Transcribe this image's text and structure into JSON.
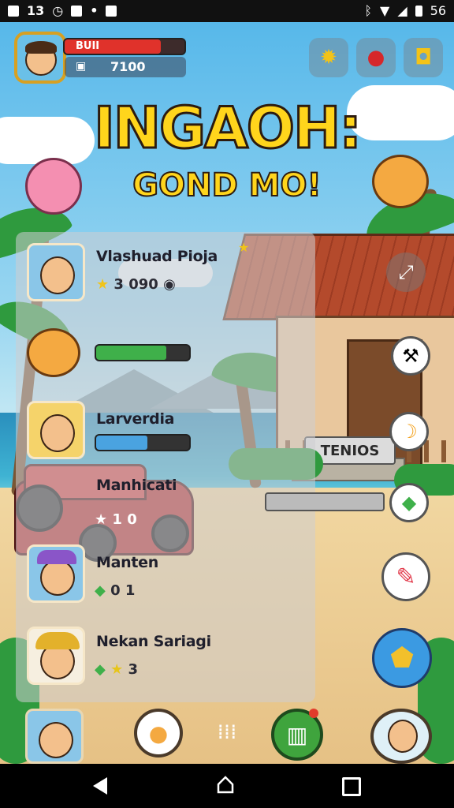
{
  "status_bar": {
    "time_left": "13",
    "battery": "56"
  },
  "hud": {
    "player_bar_label": "BUII",
    "coins": "7100",
    "health_fraction": 0.8
  },
  "title": {
    "main": "INGAOH:",
    "sub": "GOND MO!"
  },
  "list": [
    {
      "name": "Vlashuad Pioja",
      "stat": "3 090",
      "stat_icon": "star-icon"
    },
    {
      "name": "",
      "stat": "",
      "stat_icon": "progress-bar",
      "progress": 0.75
    },
    {
      "name": "Larverdia",
      "stat": "",
      "stat_icon": "progress-bar",
      "progress": 0.55
    },
    {
      "name": "Manhicati",
      "stat": "1 0",
      "stat_icon": "star-icon"
    },
    {
      "name": "Manten",
      "stat": "0 1",
      "stat_icon": "gem-icon"
    },
    {
      "name": "Nekan Sariagi",
      "stat": "3",
      "stat_icon": "gem-star-icon"
    }
  ],
  "house_sign": "TENIOS",
  "colors": {
    "title_yellow": "#ffd51c",
    "health_red": "#e0322b",
    "progress_green": "#3fb04a",
    "progress_blue": "#4aa3e0"
  }
}
